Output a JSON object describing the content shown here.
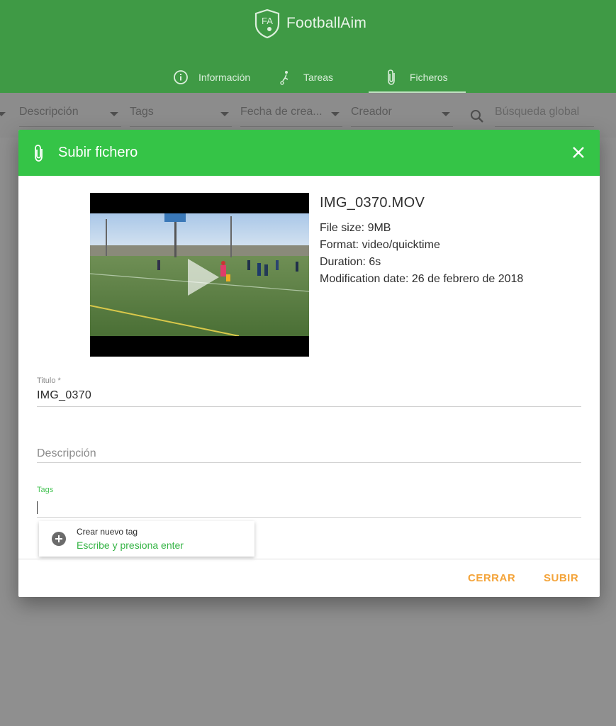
{
  "app": {
    "title": "FootballAim",
    "logo_initials": "FA"
  },
  "nav": {
    "tabs": [
      {
        "label": "Información",
        "icon": "info-circle-icon",
        "active": false
      },
      {
        "label": "Tareas",
        "icon": "kick-ball-icon",
        "active": false
      },
      {
        "label": "Ficheros",
        "icon": "paperclip-icon",
        "active": true
      }
    ]
  },
  "filters": {
    "descripcion": "Descripción",
    "tags": "Tags",
    "fecha": "Fecha de crea...",
    "creador": "Creador",
    "search_placeholder": "Búsqueda global"
  },
  "dialog": {
    "title": "Subir fichero",
    "file": {
      "name": "IMG_0370.MOV",
      "size": "File size: 9MB",
      "format": "Format: video/quicktime",
      "duration": "Duration: 6s",
      "modified": "Modification date: 26 de febrero de 2018"
    },
    "titulo_label": "Titulo *",
    "titulo_value": "IMG_0370",
    "descripcion_placeholder": "Descripción",
    "tags_label": "Tags",
    "suggestion": {
      "title": "Crear nuevo tag",
      "hint": "Escribe y presiona enter"
    },
    "buttons": {
      "close": "CERRAR",
      "upload": "SUBIR"
    }
  },
  "colors": {
    "header_bg": "#3f9a45",
    "dialog_header_bg": "#35c447",
    "accent_button": "#f4a43a",
    "tags_label": "#4cc55a"
  }
}
